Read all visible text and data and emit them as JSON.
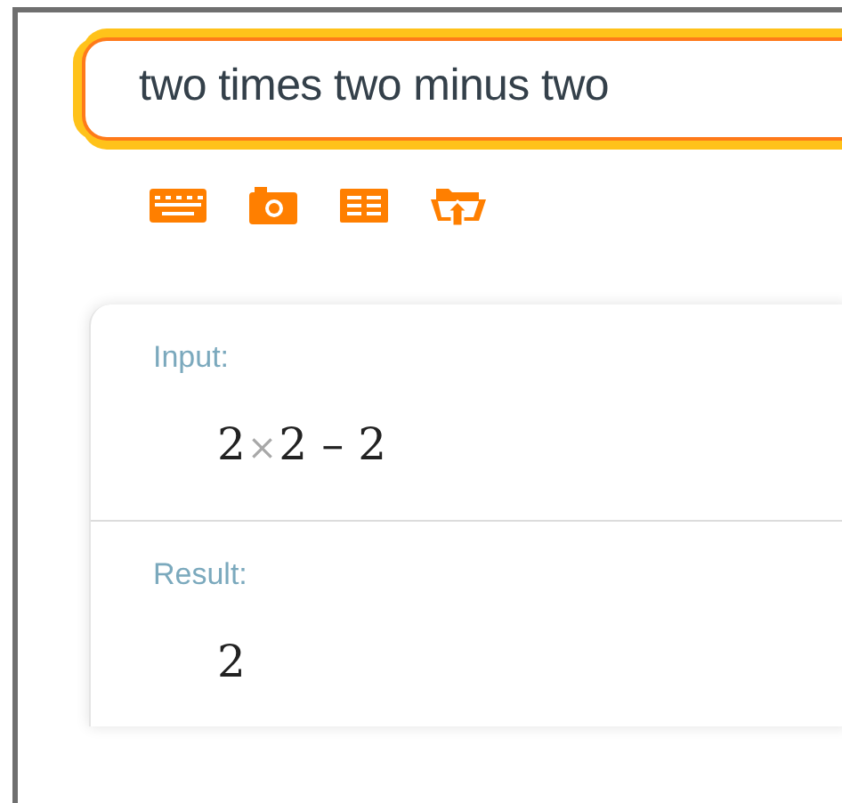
{
  "search": {
    "value": "two times two minus two"
  },
  "toolbar": [
    {
      "kind": "keyboard"
    },
    {
      "kind": "camera"
    },
    {
      "kind": "table"
    },
    {
      "kind": "upload"
    }
  ],
  "pods": [
    {
      "title": "Input:",
      "tokens": [
        {
          "text": "2",
          "kind": "number"
        },
        {
          "text": "×",
          "kind": "times"
        },
        {
          "text": "2",
          "kind": "number"
        },
        {
          "text": "–",
          "kind": "minus"
        },
        {
          "text": "2",
          "kind": "number"
        }
      ]
    },
    {
      "title": "Result:",
      "tokens": [
        {
          "text": "2",
          "kind": "number"
        }
      ]
    }
  ]
}
